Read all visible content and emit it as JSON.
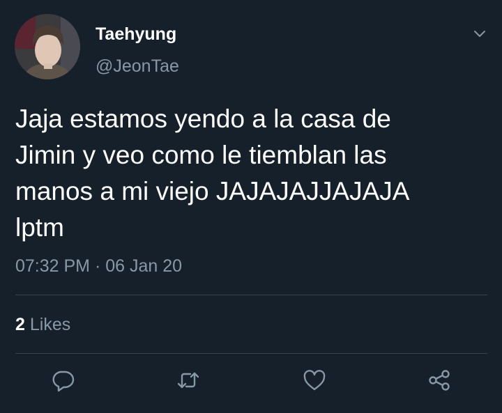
{
  "tweet": {
    "display_name": "Taehyung",
    "handle": "@JeonTae",
    "text_lines": [
      "Jaja estamos yendo a la casa de",
      "Jimin y veo como le tiemblan las",
      "manos a mi viejo JAJAJAJJAJAJA",
      "lptm"
    ],
    "time": "07:32 PM",
    "separator": "·",
    "date": "06 Jan 20",
    "likes_count": "2",
    "likes_label": "Likes"
  },
  "actions": [
    {
      "name": "reply",
      "icon": "reply-icon"
    },
    {
      "name": "retweet",
      "icon": "retweet-icon"
    },
    {
      "name": "like",
      "icon": "heart-icon"
    },
    {
      "name": "share",
      "icon": "share-icon"
    }
  ],
  "colors": {
    "background": "#15202b",
    "primary_text": "#ffffff",
    "secondary_text": "#8899a6",
    "divider": "#38444d"
  }
}
